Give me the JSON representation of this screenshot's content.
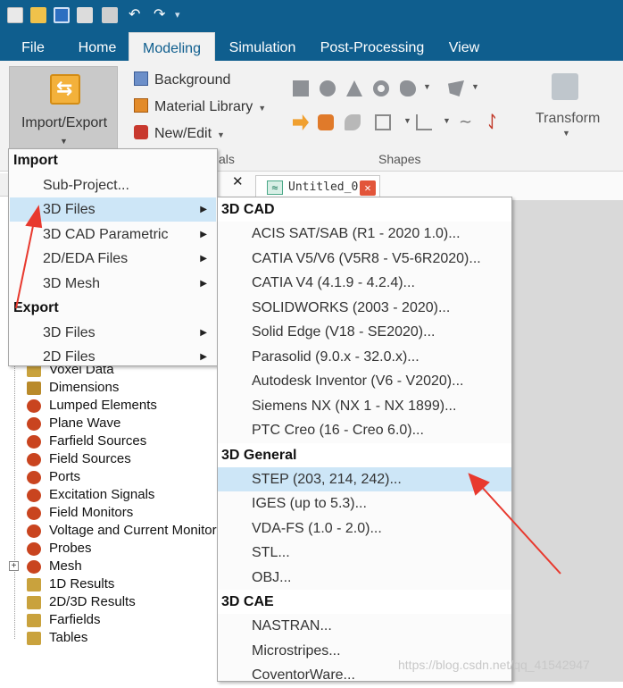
{
  "ribbon_tabs": [
    "File",
    "Home",
    "Modeling",
    "Simulation",
    "Post-Processing",
    "View"
  ],
  "active_tab": "Modeling",
  "ribbon": {
    "import_export_label": "Import/Export",
    "background_label": "Background",
    "material_library_label": "Material Library",
    "new_edit_label": "New/Edit",
    "materials_group_partial": "als",
    "shapes_group": "Shapes",
    "transform_label": "Transform"
  },
  "doc_tab": {
    "title": "Untitled_0",
    "pane_close": "✕"
  },
  "import_menu": {
    "import_header": "Import",
    "import_items": [
      {
        "label": "Sub-Project...",
        "submenu": false
      },
      {
        "label": "3D Files",
        "submenu": true
      },
      {
        "label": "3D CAD Parametric",
        "submenu": true
      },
      {
        "label": "2D/EDA Files",
        "submenu": true
      },
      {
        "label": "3D Mesh",
        "submenu": true
      }
    ],
    "export_header": "Export",
    "export_items": [
      {
        "label": "3D Files",
        "submenu": true
      },
      {
        "label": "2D Files",
        "submenu": true
      }
    ]
  },
  "files_submenu": {
    "cad_header": "3D CAD",
    "cad_items": [
      "ACIS SAT/SAB (R1 - 2020 1.0)...",
      "CATIA V5/V6 (V5R8 - V5-6R2020)...",
      "CATIA V4 (4.1.9 - 4.2.4)...",
      "SOLIDWORKS (2003 - 2020)...",
      "Solid Edge (V18 - SE2020)...",
      "Parasolid (9.0.x - 32.0.x)...",
      "Autodesk Inventor (V6 - V2020)...",
      "Siemens NX (NX 1 - NX 1899)...",
      "PTC Creo (16 - Creo 6.0)..."
    ],
    "general_header": "3D General",
    "general_items": [
      "STEP (203, 214, 242)...",
      "IGES (up to 5.3)...",
      "VDA-FS (1.0 - 2.0)...",
      "STL...",
      "OBJ..."
    ],
    "cae_header": "3D CAE",
    "cae_items": [
      "NASTRAN...",
      "Microstripes...",
      "CoventorWare..."
    ]
  },
  "tree_items": [
    "Voxel Data",
    "Dimensions",
    "Lumped Elements",
    "Plane Wave",
    "Farfield Sources",
    "Field Sources",
    "Ports",
    "Excitation Signals",
    "Field Monitors",
    "Voltage and Current Monitors",
    "Probes",
    "Mesh",
    "1D Results",
    "2D/3D Results",
    "Farfields",
    "Tables"
  ],
  "watermark": "https://blog.csdn.net/qq_41542947",
  "colors": {
    "title_bar": "#0f5e8e",
    "highlight": "#cde6f7",
    "annotation_arrow": "#e8392e"
  }
}
